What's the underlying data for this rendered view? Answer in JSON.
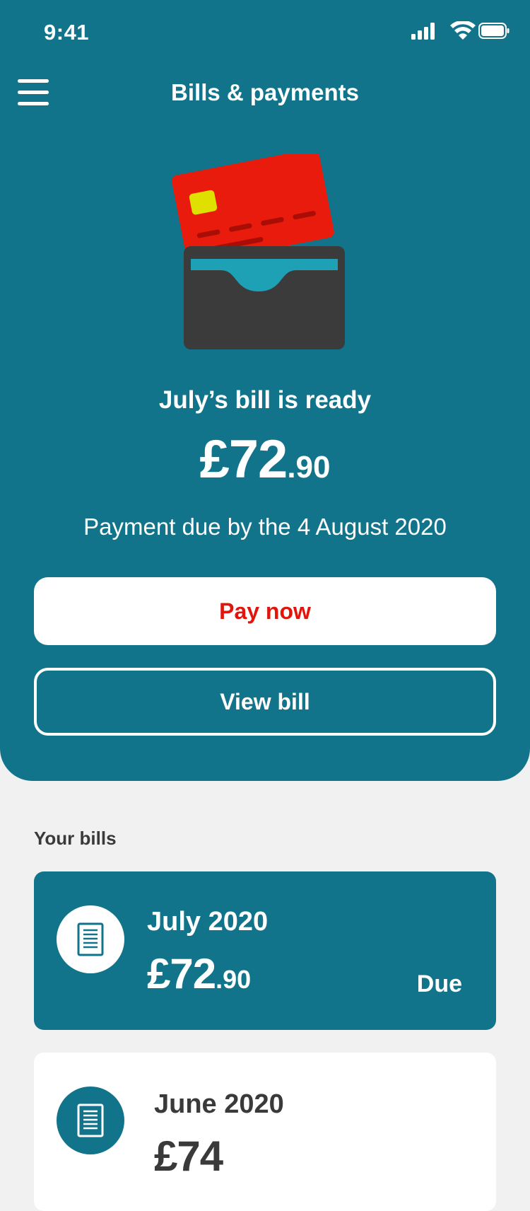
{
  "status_bar": {
    "time": "9:41"
  },
  "header": {
    "title": "Bills & payments",
    "menu_icon": "hamburger-menu-icon"
  },
  "hero": {
    "illustration": "wallet-with-credit-card",
    "headline": "July’s bill is ready",
    "amount_major": "£72",
    "amount_minor": ".90",
    "due_text": "Payment due by the 4 August 2020",
    "pay_now_label": "Pay now",
    "view_bill_label": "View bill"
  },
  "bills_section": {
    "label": "Your bills",
    "items": [
      {
        "month": "July 2020",
        "amount_major": "£72",
        "amount_minor": ".90",
        "status": "Due",
        "icon": "document-icon"
      },
      {
        "month": "June 2020",
        "amount_major": "£74",
        "amount_minor": "",
        "status": "",
        "icon": "document-icon"
      }
    ]
  },
  "colors": {
    "brand_teal": "#12748b",
    "accent_red": "#e1150c",
    "background": "#f1f1f1",
    "text_dark": "#3a3a3a"
  }
}
